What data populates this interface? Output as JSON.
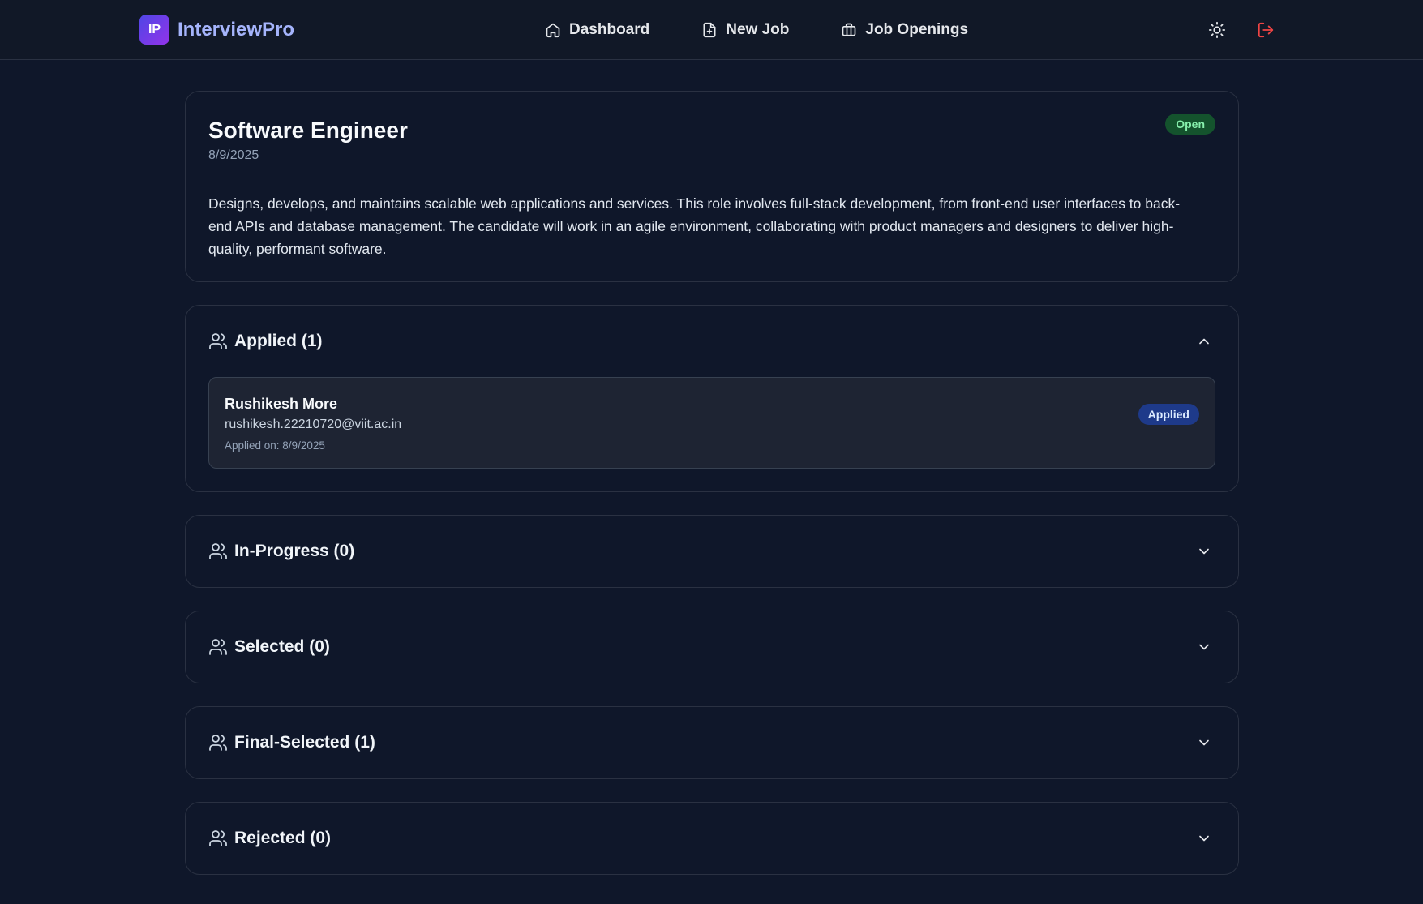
{
  "app": {
    "logo_initials": "IP",
    "name": "InterviewPro"
  },
  "nav": {
    "dashboard": "Dashboard",
    "new_job": "New Job",
    "job_openings": "Job Openings"
  },
  "colors": {
    "accent": "#a5b4fc",
    "open_badge": "#14532d",
    "applied_badge": "#1e3a8a",
    "logout": "#ef4444"
  },
  "job": {
    "title": "Software Engineer",
    "date": "8/9/2025",
    "status": "Open",
    "description": "Designs, develops, and maintains scalable web applications and services. This role involves full-stack development, from front-end user interfaces to back-end APIs and database management. The candidate will work in an agile environment, collaborating with product managers and designers to deliver high-quality, performant software."
  },
  "sections": [
    {
      "title": "Applied (1)",
      "expanded": true
    },
    {
      "title": "In-Progress (0)",
      "expanded": false
    },
    {
      "title": "Selected (0)",
      "expanded": false
    },
    {
      "title": "Final-Selected (1)",
      "expanded": false
    },
    {
      "title": "Rejected (0)",
      "expanded": false
    }
  ],
  "applicants": [
    {
      "name": "Rushikesh More",
      "email": "rushikesh.22210720@viit.ac.in",
      "applied_on": "Applied on: 8/9/2025",
      "status": "Applied"
    }
  ]
}
